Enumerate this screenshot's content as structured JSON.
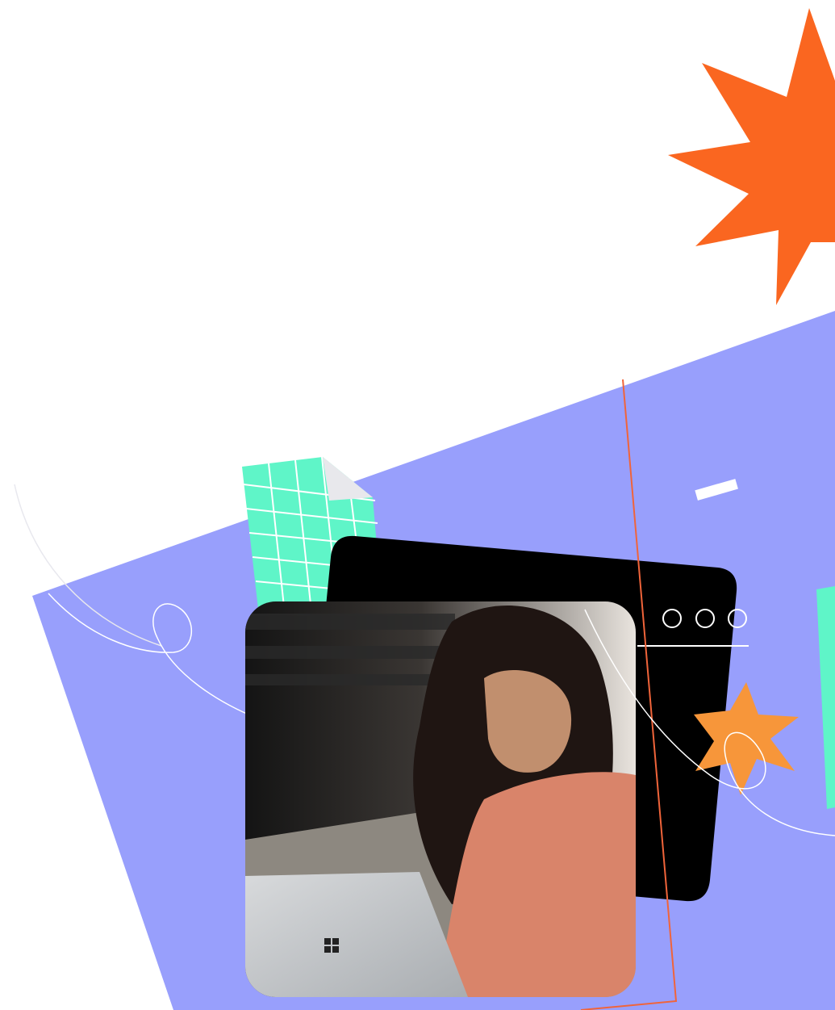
{
  "scene": {
    "description_free": true
  },
  "colors": {
    "background": "#ffffff",
    "panel": "#989ffc",
    "starburst_large": "#fa6620",
    "starburst_small": "#f7963a",
    "grid_paper": "#5ff5c8",
    "grid_lines": "#ffffff",
    "browser_window": "#000000",
    "accent_line": "#f0643a",
    "sweater": "#d9846a",
    "laptop": "#c9cccf"
  },
  "browser_window": {
    "controls": [
      "circle",
      "circle",
      "circle"
    ]
  },
  "icons": {
    "starburst": "starburst-icon",
    "window_dot": "window-control-dot-icon",
    "laptop_logo": "windows-logo-icon"
  }
}
